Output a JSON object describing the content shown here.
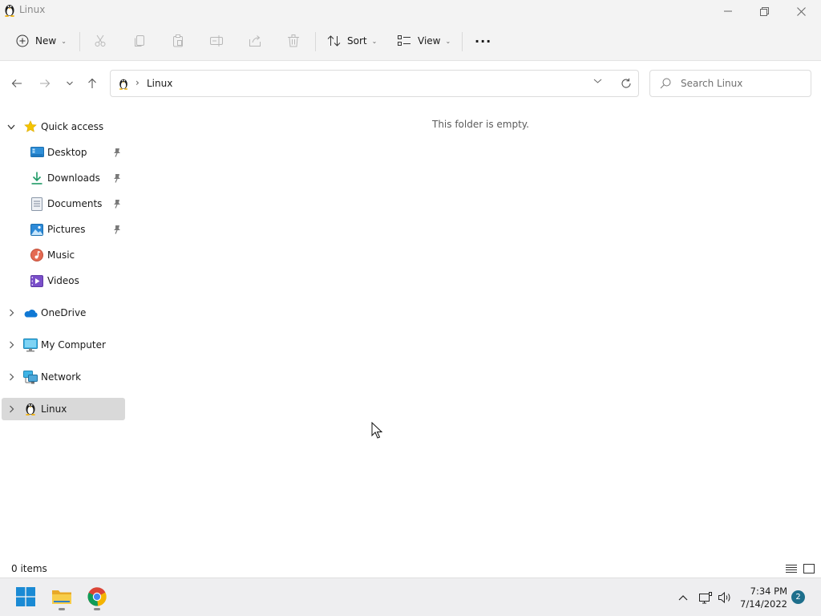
{
  "window": {
    "title": "Linux",
    "controls": {
      "minimize": "minimize",
      "maximize": "maximize",
      "close": "close"
    }
  },
  "commandbar": {
    "new_label": "New",
    "sort_label": "Sort",
    "view_label": "View",
    "more_label": "···",
    "actions": [
      "cut",
      "copy",
      "paste",
      "rename",
      "share",
      "delete"
    ]
  },
  "address": {
    "crumbs": [
      "Linux"
    ],
    "search_placeholder": "Search Linux"
  },
  "sidebar": {
    "quick_access": {
      "label": "Quick access",
      "items": [
        {
          "label": "Desktop",
          "icon": "desktop-icon",
          "pinned": true
        },
        {
          "label": "Downloads",
          "icon": "downloads-icon",
          "pinned": true
        },
        {
          "label": "Documents",
          "icon": "documents-icon",
          "pinned": true
        },
        {
          "label": "Pictures",
          "icon": "pictures-icon",
          "pinned": true
        },
        {
          "label": "Music",
          "icon": "music-icon",
          "pinned": false
        },
        {
          "label": "Videos",
          "icon": "videos-icon",
          "pinned": false
        }
      ]
    },
    "roots": [
      {
        "label": "OneDrive",
        "icon": "onedrive-icon"
      },
      {
        "label": "My Computer",
        "icon": "computer-icon"
      },
      {
        "label": "Network",
        "icon": "network-icon"
      },
      {
        "label": "Linux",
        "icon": "linux-icon",
        "selected": true
      }
    ]
  },
  "content": {
    "empty_message": "This folder is empty."
  },
  "statusbar": {
    "item_count": "0 items"
  },
  "taskbar": {
    "apps": [
      "start",
      "file-explorer",
      "chrome"
    ],
    "clock_time": "7:34 PM",
    "clock_date": "7/14/2022",
    "notification_count": "2"
  },
  "colors": {
    "chrome_bg": "#f3f3f3",
    "selected_bg": "#d9d9d9",
    "accent": "#0067c0",
    "folder_yellow": "#f4c142"
  }
}
